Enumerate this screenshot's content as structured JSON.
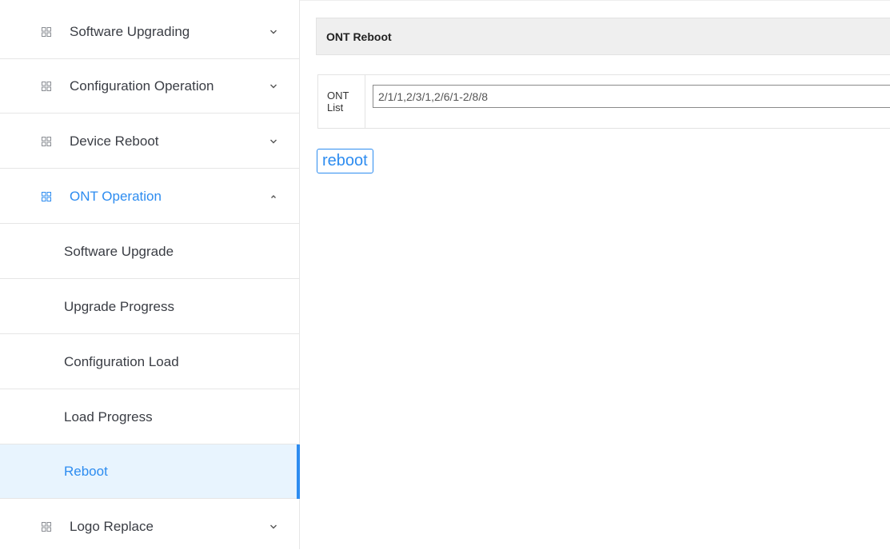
{
  "sidebar": {
    "groups": [
      {
        "label": "Software Upgrading",
        "expanded": false
      },
      {
        "label": "Configuration Operation",
        "expanded": false
      },
      {
        "label": "Device Reboot",
        "expanded": false
      },
      {
        "label": "ONT Operation",
        "expanded": true
      },
      {
        "label": "Logo Replace",
        "expanded": false
      }
    ],
    "ont_items": [
      {
        "label": "Software Upgrade"
      },
      {
        "label": "Upgrade Progress"
      },
      {
        "label": "Configuration Load"
      },
      {
        "label": "Load Progress"
      },
      {
        "label": "Reboot",
        "selected": true
      }
    ]
  },
  "main": {
    "section_title": "ONT Reboot",
    "form": {
      "label_line1": "ONT",
      "label_line2": "List",
      "ont_list_value": "2/1/1,2/3/1,2/6/1-2/8/8"
    },
    "reboot_button": "reboot"
  },
  "colors": {
    "accent": "#2d8cf0",
    "selected_bg": "#e8f4fe",
    "border": "#e6e6e6",
    "header_bg": "#efefef"
  },
  "icons": {
    "group_icon": "grid-icon",
    "collapsed": "chevron-down-icon",
    "expanded": "chevron-up-icon"
  }
}
